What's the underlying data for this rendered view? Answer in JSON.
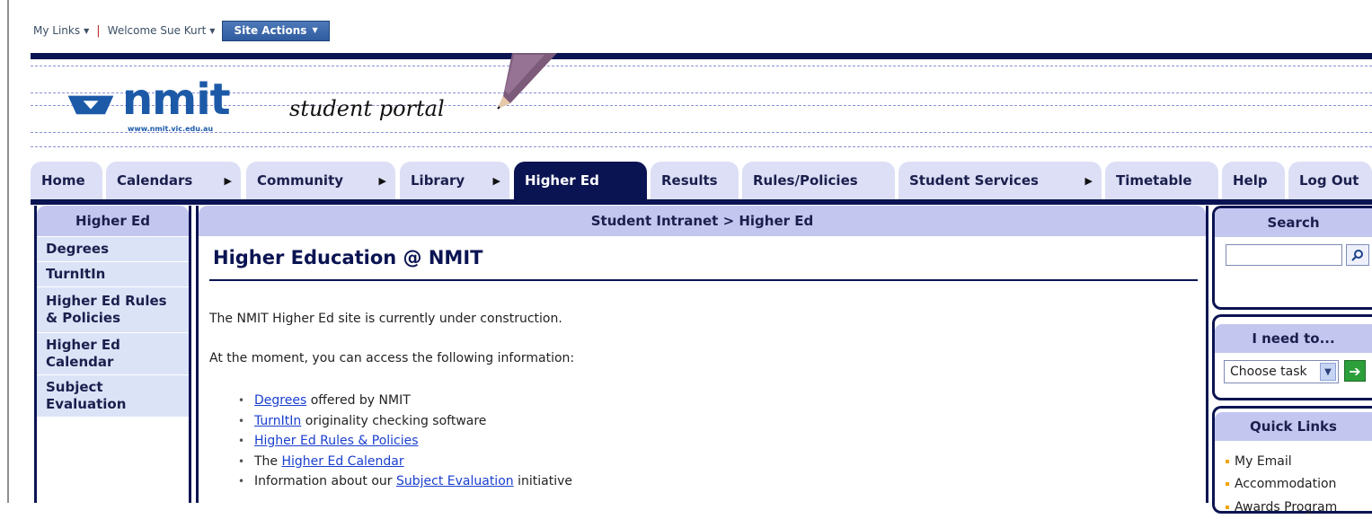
{
  "topbar": {
    "my_links": "My Links",
    "welcome": "Welcome Sue Kurt",
    "site_actions": "Site Actions"
  },
  "banner": {
    "logo_text": "nmit",
    "logo_url": "www.nmit.vic.edu.au",
    "tagline": "student portal"
  },
  "nav": {
    "tabs": [
      {
        "label": "Home"
      },
      {
        "label": "Calendars"
      },
      {
        "label": "Community"
      },
      {
        "label": "Library"
      },
      {
        "label": "Higher Ed"
      },
      {
        "label": "Results"
      },
      {
        "label": "Rules/Policies"
      },
      {
        "label": "Student Services"
      },
      {
        "label": "Timetable"
      },
      {
        "label": "Help"
      },
      {
        "label": "Log Out"
      }
    ],
    "active": "Higher Ed"
  },
  "leftnav": {
    "title": "Higher Ed",
    "items": [
      {
        "label": "Degrees"
      },
      {
        "label": "TurnItIn"
      },
      {
        "label": "Higher Ed Rules & Policies"
      },
      {
        "label": "Higher Ed Calendar"
      },
      {
        "label": "Subject Evaluation"
      }
    ]
  },
  "main": {
    "breadcrumb": "Student Intranet > Higher Ed",
    "heading": "Higher Education @ NMIT",
    "para1": "The NMIT Higher Ed site is currently under construction.",
    "para2": "At the moment, you can access the following information:",
    "list": [
      {
        "pre": "",
        "link": "Degrees",
        "post": " offered by NMIT"
      },
      {
        "pre": "",
        "link": "TurnItIn",
        "post": " originality checking software"
      },
      {
        "pre": "",
        "link": "Higher Ed Rules & Policies",
        "post": ""
      },
      {
        "pre": "The ",
        "link": "Higher Ed Calendar",
        "post": ""
      },
      {
        "pre": "Information about our ",
        "link": "Subject Evaluation",
        "post": " initiative"
      }
    ]
  },
  "right": {
    "search_title": "Search",
    "search_value": "",
    "need_title": "I need to...",
    "task_selected": "Choose task",
    "quick_title": "Quick Links",
    "quick_links": [
      {
        "label": "My Email"
      },
      {
        "label": "Accommodation"
      },
      {
        "label": "Awards Program"
      }
    ]
  },
  "colors": {
    "navy": "#0b1452",
    "tab_bg": "#dcdff5",
    "header_bg": "#c3c6ef",
    "leftnav_item_bg": "#dbe3f7",
    "link": "#1a3fcf",
    "bullet_orange": "#f0a500"
  },
  "icons": {
    "search_button": "magnifier-icon",
    "go_button": "green-arrow-icon",
    "dropdown": "chevron-down-icon"
  }
}
